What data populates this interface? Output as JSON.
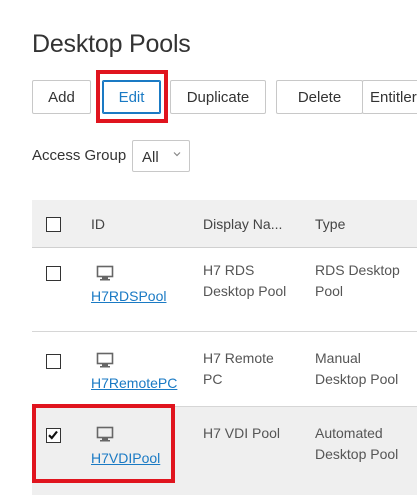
{
  "page": {
    "title": "Desktop Pools"
  },
  "toolbar": {
    "add_label": "Add",
    "edit_label": "Edit",
    "duplicate_label": "Duplicate",
    "delete_label": "Delete",
    "entitle_label": "Entitler"
  },
  "filter": {
    "label": "Access Group",
    "selected": "All",
    "icon": "chevron-down-icon"
  },
  "table": {
    "columns": [
      "ID",
      "Display Na...",
      "Type"
    ],
    "rows": [
      {
        "checked": false,
        "icon": "monitor-icon",
        "id": "H7RDSPool",
        "display_name": [
          "H7 RDS",
          "Desktop Pool"
        ],
        "type": [
          "RDS Desktop",
          "Pool"
        ]
      },
      {
        "checked": false,
        "icon": "monitor-icon",
        "id": "H7RemotePC",
        "display_name": [
          "H7 Remote",
          "PC"
        ],
        "type": [
          "Manual",
          "Desktop Pool"
        ]
      },
      {
        "checked": true,
        "icon": "monitor-icon",
        "id": "H7VDIPool",
        "display_name": [
          "H7 VDI Pool"
        ],
        "type": [
          "Automated",
          "Desktop Pool"
        ]
      }
    ]
  },
  "colors": {
    "accent": "#1a7ac4",
    "highlight": "#e0141e",
    "selected_row": "#efefef"
  }
}
